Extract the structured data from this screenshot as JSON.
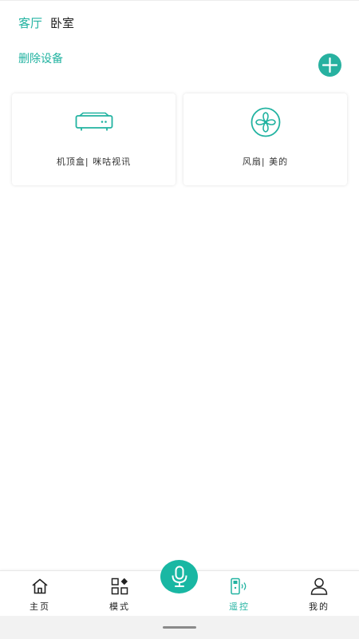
{
  "rooms": [
    {
      "label": "客厅",
      "active": true
    },
    {
      "label": "卧室",
      "active": false
    }
  ],
  "actions": {
    "delete_label": "删除设备"
  },
  "devices": [
    {
      "label": "机顶盒| 咪咕视讯",
      "icon": "set-top-box-icon"
    },
    {
      "label": "风扇| 美的",
      "icon": "fan-icon"
    }
  ],
  "nav": {
    "items": [
      {
        "label": "主页",
        "icon": "home-icon"
      },
      {
        "label": "模式",
        "icon": "modes-icon"
      },
      {
        "label": "遥控",
        "icon": "remote-icon",
        "active": true
      },
      {
        "label": "我的",
        "icon": "user-icon"
      }
    ],
    "center": {
      "icon": "microphone-icon"
    }
  },
  "colors": {
    "accent": "#22b3a1",
    "text": "#222222",
    "background": "#ffffff"
  }
}
